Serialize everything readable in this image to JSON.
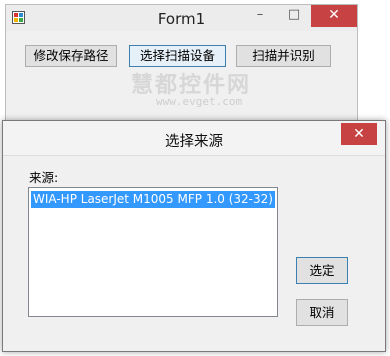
{
  "form1": {
    "title": "Form1",
    "window_controls": {
      "minimize": "–",
      "maximize": "□",
      "close": "✕"
    },
    "buttons": [
      {
        "label": "修改保存路径"
      },
      {
        "label": "选择扫描设备"
      },
      {
        "label": "扫描并识别"
      }
    ],
    "watermark": {
      "text": "慧都控件网",
      "url": "www.evget.com"
    }
  },
  "dialog": {
    "title": "选择来源",
    "close_glyph": "✕",
    "source_label": "来源:",
    "sources": [
      {
        "label": "WIA-HP LaserJet M1005 MFP 1.0 (32-32)",
        "selected": true
      }
    ],
    "select_button": "选定",
    "cancel_button": "取消"
  },
  "colors": {
    "close_red": "#c74343",
    "selection_blue": "#3399ff"
  }
}
